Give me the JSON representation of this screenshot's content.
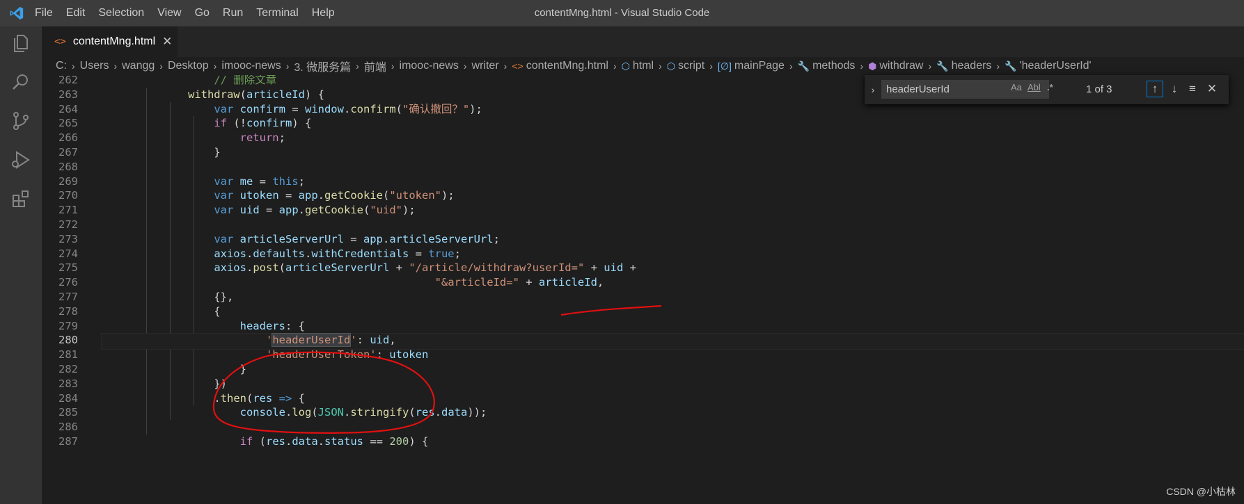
{
  "window": {
    "title": "contentMng.html - Visual Studio Code"
  },
  "menu": [
    "File",
    "Edit",
    "Selection",
    "View",
    "Go",
    "Run",
    "Terminal",
    "Help"
  ],
  "activity_bar": [
    "files-icon",
    "search-icon",
    "source-control-icon",
    "run-debug-icon",
    "extensions-icon"
  ],
  "tab": {
    "label": "contentMng.html",
    "icon": "<>",
    "close": "✕"
  },
  "breadcrumb": [
    {
      "label": "C:",
      "icon": ""
    },
    {
      "label": "Users",
      "icon": ""
    },
    {
      "label": "wangg",
      "icon": ""
    },
    {
      "label": "Desktop",
      "icon": ""
    },
    {
      "label": "imooc-news",
      "icon": ""
    },
    {
      "label": "3. 微服务篇",
      "icon": ""
    },
    {
      "label": "前端",
      "icon": ""
    },
    {
      "label": "imooc-news",
      "icon": ""
    },
    {
      "label": "writer",
      "icon": ""
    },
    {
      "label": "contentMng.html",
      "icon": "<>"
    },
    {
      "label": "html",
      "icon": "⬡"
    },
    {
      "label": "script",
      "icon": "⬡"
    },
    {
      "label": "mainPage",
      "icon": "[∅]"
    },
    {
      "label": "methods",
      "icon": "🔧"
    },
    {
      "label": "withdraw",
      "icon": "⬢"
    },
    {
      "label": "headers",
      "icon": "🔧"
    },
    {
      "label": "'headerUserId'",
      "icon": "🔧"
    }
  ],
  "find": {
    "query": "headerUserId",
    "match_case": "Aa",
    "whole_word": "Abl",
    "regex": ".*",
    "count": "1 of 3",
    "prev": "↑",
    "next": "↓",
    "selection": "≡",
    "close": "✕",
    "toggle": "›"
  },
  "editor": {
    "active_line": "280",
    "lines": [
      {
        "n": "262",
        "indent": 0,
        "tokens": [
          [
            "                ",
            ""
          ],
          [
            "// 删除文章",
            "cmt"
          ]
        ]
      },
      {
        "n": "263",
        "tokens": [
          [
            "            ",
            ""
          ],
          [
            "withdraw",
            "fn"
          ],
          [
            "(",
            ""
          ],
          [
            "articleId",
            "var"
          ],
          [
            ") {",
            ""
          ]
        ]
      },
      {
        "n": "264",
        "tokens": [
          [
            "                ",
            ""
          ],
          [
            "var",
            "kw"
          ],
          [
            " ",
            ""
          ],
          [
            "confirm",
            "var"
          ],
          [
            " = ",
            ""
          ],
          [
            "window",
            "var"
          ],
          [
            ".",
            ""
          ],
          [
            "confirm",
            "fn"
          ],
          [
            "(",
            ""
          ],
          [
            "\"确认撤回？\"",
            "str"
          ],
          [
            ");",
            ""
          ]
        ]
      },
      {
        "n": "265",
        "tokens": [
          [
            "                ",
            ""
          ],
          [
            "if",
            "kw2"
          ],
          [
            " (!",
            ""
          ],
          [
            "confirm",
            "var"
          ],
          [
            ") {",
            ""
          ]
        ]
      },
      {
        "n": "266",
        "tokens": [
          [
            "                    ",
            ""
          ],
          [
            "return",
            "kw2"
          ],
          [
            ";",
            ""
          ]
        ]
      },
      {
        "n": "267",
        "tokens": [
          [
            "                ",
            ""
          ],
          [
            "}",
            ""
          ]
        ]
      },
      {
        "n": "268",
        "tokens": []
      },
      {
        "n": "269",
        "tokens": [
          [
            "                ",
            ""
          ],
          [
            "var",
            "kw"
          ],
          [
            " ",
            ""
          ],
          [
            "me",
            "var"
          ],
          [
            " = ",
            ""
          ],
          [
            "this",
            "kw"
          ],
          [
            ";",
            ""
          ]
        ]
      },
      {
        "n": "270",
        "tokens": [
          [
            "                ",
            ""
          ],
          [
            "var",
            "kw"
          ],
          [
            " ",
            ""
          ],
          [
            "utoken",
            "var"
          ],
          [
            " = ",
            ""
          ],
          [
            "app",
            "var"
          ],
          [
            ".",
            ""
          ],
          [
            "getCookie",
            "fn"
          ],
          [
            "(",
            ""
          ],
          [
            "\"utoken\"",
            "str"
          ],
          [
            ");",
            ""
          ]
        ]
      },
      {
        "n": "271",
        "tokens": [
          [
            "                ",
            ""
          ],
          [
            "var",
            "kw"
          ],
          [
            " ",
            ""
          ],
          [
            "uid",
            "var"
          ],
          [
            " = ",
            ""
          ],
          [
            "app",
            "var"
          ],
          [
            ".",
            ""
          ],
          [
            "getCookie",
            "fn"
          ],
          [
            "(",
            ""
          ],
          [
            "\"uid\"",
            "str"
          ],
          [
            ");",
            ""
          ]
        ]
      },
      {
        "n": "272",
        "tokens": []
      },
      {
        "n": "273",
        "tokens": [
          [
            "                ",
            ""
          ],
          [
            "var",
            "kw"
          ],
          [
            " ",
            ""
          ],
          [
            "articleServerUrl",
            "var"
          ],
          [
            " = ",
            ""
          ],
          [
            "app",
            "var"
          ],
          [
            ".",
            ""
          ],
          [
            "articleServerUrl",
            "var"
          ],
          [
            ";",
            ""
          ]
        ]
      },
      {
        "n": "274",
        "tokens": [
          [
            "                ",
            ""
          ],
          [
            "axios",
            "var"
          ],
          [
            ".",
            ""
          ],
          [
            "defaults",
            "var"
          ],
          [
            ".",
            ""
          ],
          [
            "withCredentials",
            "var"
          ],
          [
            " = ",
            ""
          ],
          [
            "true",
            "kw"
          ],
          [
            ";",
            ""
          ]
        ]
      },
      {
        "n": "275",
        "tokens": [
          [
            "                ",
            ""
          ],
          [
            "axios",
            "var"
          ],
          [
            ".",
            ""
          ],
          [
            "post",
            "fn"
          ],
          [
            "(",
            ""
          ],
          [
            "articleServerUrl",
            "var"
          ],
          [
            " + ",
            ""
          ],
          [
            "\"/article/withdraw?userId=\"",
            "str"
          ],
          [
            " + ",
            ""
          ],
          [
            "uid",
            "var"
          ],
          [
            " +",
            ""
          ]
        ]
      },
      {
        "n": "276",
        "tokens": [
          [
            "                                                  ",
            ""
          ],
          [
            "\"&articleId=\"",
            "str"
          ],
          [
            " + ",
            ""
          ],
          [
            "articleId",
            "var"
          ],
          [
            ",",
            ""
          ]
        ]
      },
      {
        "n": "277",
        "tokens": [
          [
            "                ",
            ""
          ],
          [
            "{},",
            ""
          ]
        ]
      },
      {
        "n": "278",
        "tokens": [
          [
            "                ",
            ""
          ],
          [
            "{",
            ""
          ]
        ]
      },
      {
        "n": "279",
        "tokens": [
          [
            "                    ",
            ""
          ],
          [
            "headers",
            "var"
          ],
          [
            ": {",
            ""
          ]
        ]
      },
      {
        "n": "280",
        "tokens": [
          [
            "                        ",
            ""
          ],
          [
            "'",
            "str"
          ],
          [
            "headerUserId",
            "str hl"
          ],
          [
            "'",
            "str"
          ],
          [
            ": ",
            ""
          ],
          [
            "uid",
            "var"
          ],
          [
            ",",
            ""
          ]
        ]
      },
      {
        "n": "281",
        "tokens": [
          [
            "                        ",
            ""
          ],
          [
            "'headerUserToken'",
            "str"
          ],
          [
            ": ",
            ""
          ],
          [
            "utoken",
            "var"
          ]
        ]
      },
      {
        "n": "282",
        "tokens": [
          [
            "                    ",
            ""
          ],
          [
            "}",
            ""
          ]
        ]
      },
      {
        "n": "283",
        "tokens": [
          [
            "                ",
            ""
          ],
          [
            "})",
            ""
          ]
        ]
      },
      {
        "n": "284",
        "tokens": [
          [
            "                ",
            ""
          ],
          [
            ".",
            ""
          ],
          [
            "then",
            "fn"
          ],
          [
            "(",
            ""
          ],
          [
            "res",
            "var"
          ],
          [
            " ",
            ""
          ],
          [
            "=>",
            "kw"
          ],
          [
            " {",
            ""
          ]
        ]
      },
      {
        "n": "285",
        "tokens": [
          [
            "                    ",
            ""
          ],
          [
            "console",
            "var"
          ],
          [
            ".",
            ""
          ],
          [
            "log",
            "fn"
          ],
          [
            "(",
            ""
          ],
          [
            "JSON",
            "cls"
          ],
          [
            ".",
            ""
          ],
          [
            "stringify",
            "fn"
          ],
          [
            "(",
            ""
          ],
          [
            "res",
            "var"
          ],
          [
            ".",
            ""
          ],
          [
            "data",
            "var"
          ],
          [
            "));",
            ""
          ]
        ]
      },
      {
        "n": "286",
        "tokens": []
      },
      {
        "n": "287",
        "tokens": [
          [
            "                    ",
            ""
          ],
          [
            "if",
            "kw2"
          ],
          [
            " (",
            ""
          ],
          [
            "res",
            "var"
          ],
          [
            ".",
            ""
          ],
          [
            "data",
            "var"
          ],
          [
            ".",
            ""
          ],
          [
            "status",
            "var"
          ],
          [
            " == ",
            ""
          ],
          [
            "200",
            "num"
          ],
          [
            ") {",
            ""
          ]
        ]
      }
    ]
  },
  "watermark": "CSDN @小枯林"
}
